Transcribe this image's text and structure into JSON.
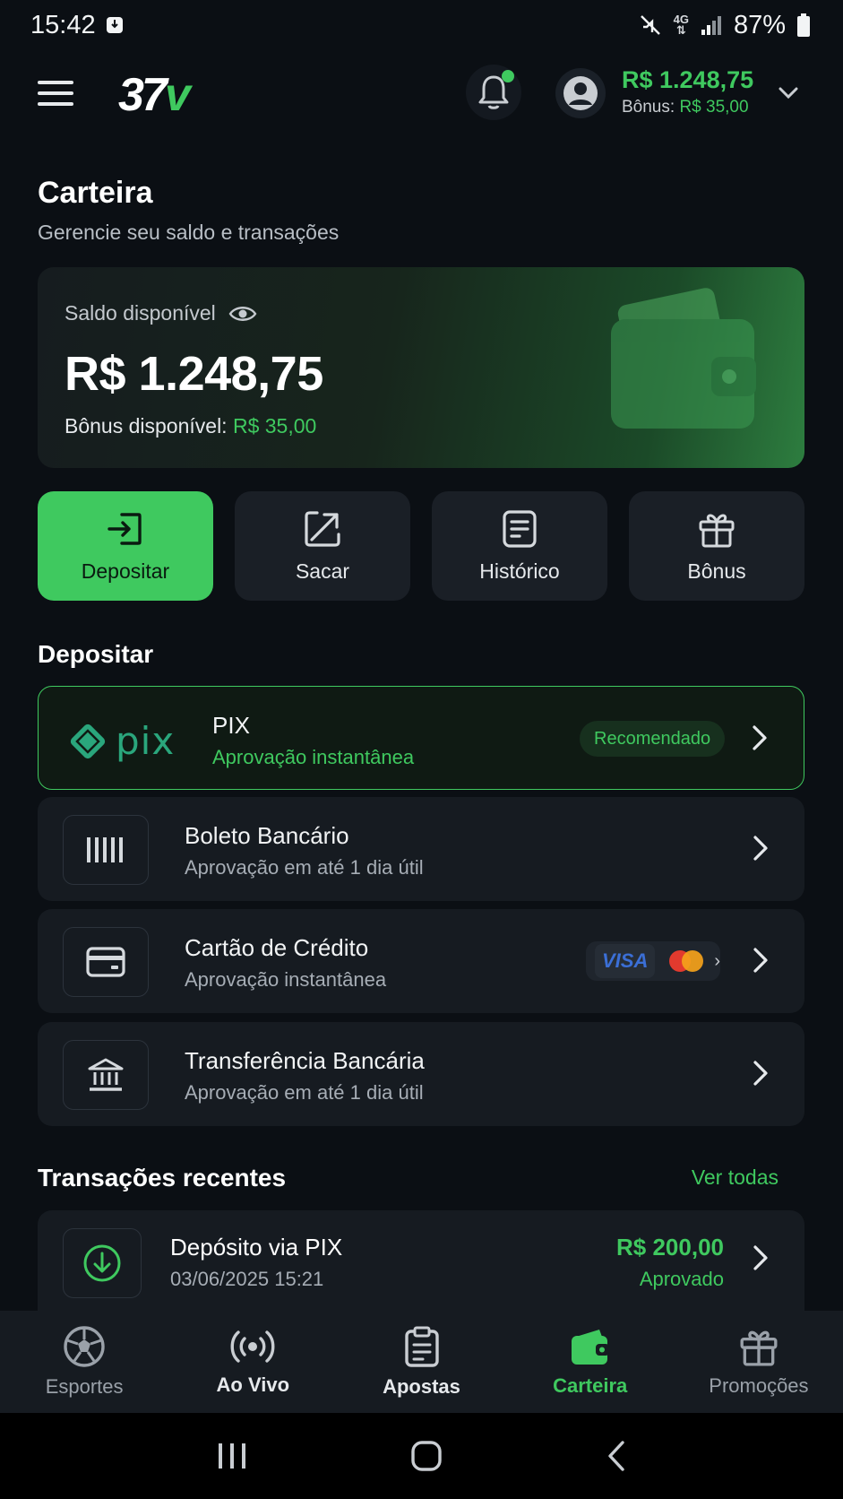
{
  "status_bar": {
    "time": "15:42",
    "network": "4G",
    "battery": "87%"
  },
  "header": {
    "logo_main": "37",
    "logo_accent": "v",
    "balance": "R$ 1.248,75",
    "bonus_label": "Bônus:",
    "bonus_value": "R$ 35,00"
  },
  "page": {
    "title": "Carteira",
    "subtitle": "Gerencie seu saldo e transações"
  },
  "balance_card": {
    "label": "Saldo disponível",
    "amount": "R$ 1.248,75",
    "bonus_label": "Bônus disponível:",
    "bonus_value": "R$ 35,00"
  },
  "actions": [
    {
      "label": "Depositar",
      "icon": "deposit-icon",
      "active": true
    },
    {
      "label": "Sacar",
      "icon": "withdraw-icon",
      "active": false
    },
    {
      "label": "Histórico",
      "icon": "history-icon",
      "active": false
    },
    {
      "label": "Bônus",
      "icon": "gift-icon",
      "active": false
    }
  ],
  "deposit": {
    "section_title": "Depositar",
    "methods": [
      {
        "title": "PIX",
        "subtitle": "Aprovação instantânea",
        "logo_text": "pix",
        "badge": "Recomendado"
      },
      {
        "title": "Boleto Bancário",
        "subtitle": "Aprovação em até 1 dia útil",
        "icon": "barcode-icon"
      },
      {
        "title": "Cartão de Crédito",
        "subtitle": "Aprovação instantânea",
        "icon": "credit-card-icon",
        "brands": [
          "VISA",
          "mastercard"
        ]
      },
      {
        "title": "Transferência Bancária",
        "subtitle": "Aprovação em até 1 dia útil",
        "icon": "bank-icon"
      }
    ]
  },
  "recent": {
    "section_title": "Transações recentes",
    "see_all": "Ver todas",
    "items": [
      {
        "title": "Depósito via PIX",
        "date": "03/06/2025 15:21",
        "amount": "R$ 200,00",
        "status": "Aprovado",
        "icon": "download-circle-icon"
      }
    ]
  },
  "bottom_nav": [
    {
      "label": "Esportes",
      "icon": "soccer-ball-icon"
    },
    {
      "label": "Ao Vivo",
      "icon": "live-broadcast-icon"
    },
    {
      "label": "Apostas",
      "icon": "clipboard-icon"
    },
    {
      "label": "Carteira",
      "icon": "wallet-icon",
      "active": true
    },
    {
      "label": "Promoções",
      "icon": "gift-icon"
    }
  ],
  "colors": {
    "accent": "#3fc95f",
    "background": "#0b0f14",
    "card": "#161b21"
  }
}
